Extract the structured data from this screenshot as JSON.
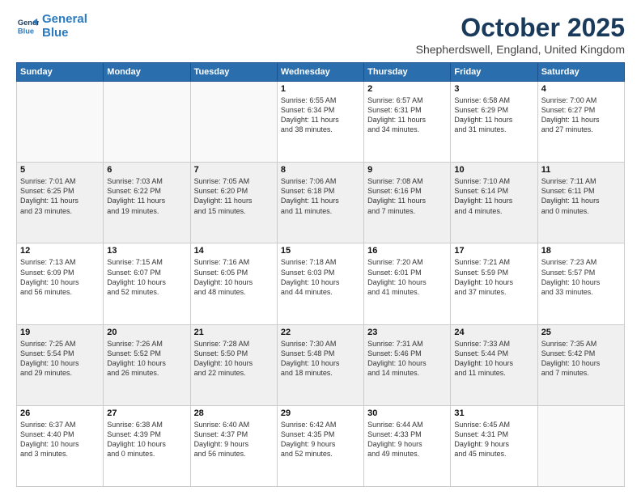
{
  "logo": {
    "line1": "General",
    "line2": "Blue"
  },
  "title": "October 2025",
  "location": "Shepherdswell, England, United Kingdom",
  "days_of_week": [
    "Sunday",
    "Monday",
    "Tuesday",
    "Wednesday",
    "Thursday",
    "Friday",
    "Saturday"
  ],
  "weeks": [
    [
      {
        "day": "",
        "info": ""
      },
      {
        "day": "",
        "info": ""
      },
      {
        "day": "",
        "info": ""
      },
      {
        "day": "1",
        "info": "Sunrise: 6:55 AM\nSunset: 6:34 PM\nDaylight: 11 hours\nand 38 minutes."
      },
      {
        "day": "2",
        "info": "Sunrise: 6:57 AM\nSunset: 6:31 PM\nDaylight: 11 hours\nand 34 minutes."
      },
      {
        "day": "3",
        "info": "Sunrise: 6:58 AM\nSunset: 6:29 PM\nDaylight: 11 hours\nand 31 minutes."
      },
      {
        "day": "4",
        "info": "Sunrise: 7:00 AM\nSunset: 6:27 PM\nDaylight: 11 hours\nand 27 minutes."
      }
    ],
    [
      {
        "day": "5",
        "info": "Sunrise: 7:01 AM\nSunset: 6:25 PM\nDaylight: 11 hours\nand 23 minutes."
      },
      {
        "day": "6",
        "info": "Sunrise: 7:03 AM\nSunset: 6:22 PM\nDaylight: 11 hours\nand 19 minutes."
      },
      {
        "day": "7",
        "info": "Sunrise: 7:05 AM\nSunset: 6:20 PM\nDaylight: 11 hours\nand 15 minutes."
      },
      {
        "day": "8",
        "info": "Sunrise: 7:06 AM\nSunset: 6:18 PM\nDaylight: 11 hours\nand 11 minutes."
      },
      {
        "day": "9",
        "info": "Sunrise: 7:08 AM\nSunset: 6:16 PM\nDaylight: 11 hours\nand 7 minutes."
      },
      {
        "day": "10",
        "info": "Sunrise: 7:10 AM\nSunset: 6:14 PM\nDaylight: 11 hours\nand 4 minutes."
      },
      {
        "day": "11",
        "info": "Sunrise: 7:11 AM\nSunset: 6:11 PM\nDaylight: 11 hours\nand 0 minutes."
      }
    ],
    [
      {
        "day": "12",
        "info": "Sunrise: 7:13 AM\nSunset: 6:09 PM\nDaylight: 10 hours\nand 56 minutes."
      },
      {
        "day": "13",
        "info": "Sunrise: 7:15 AM\nSunset: 6:07 PM\nDaylight: 10 hours\nand 52 minutes."
      },
      {
        "day": "14",
        "info": "Sunrise: 7:16 AM\nSunset: 6:05 PM\nDaylight: 10 hours\nand 48 minutes."
      },
      {
        "day": "15",
        "info": "Sunrise: 7:18 AM\nSunset: 6:03 PM\nDaylight: 10 hours\nand 44 minutes."
      },
      {
        "day": "16",
        "info": "Sunrise: 7:20 AM\nSunset: 6:01 PM\nDaylight: 10 hours\nand 41 minutes."
      },
      {
        "day": "17",
        "info": "Sunrise: 7:21 AM\nSunset: 5:59 PM\nDaylight: 10 hours\nand 37 minutes."
      },
      {
        "day": "18",
        "info": "Sunrise: 7:23 AM\nSunset: 5:57 PM\nDaylight: 10 hours\nand 33 minutes."
      }
    ],
    [
      {
        "day": "19",
        "info": "Sunrise: 7:25 AM\nSunset: 5:54 PM\nDaylight: 10 hours\nand 29 minutes."
      },
      {
        "day": "20",
        "info": "Sunrise: 7:26 AM\nSunset: 5:52 PM\nDaylight: 10 hours\nand 26 minutes."
      },
      {
        "day": "21",
        "info": "Sunrise: 7:28 AM\nSunset: 5:50 PM\nDaylight: 10 hours\nand 22 minutes."
      },
      {
        "day": "22",
        "info": "Sunrise: 7:30 AM\nSunset: 5:48 PM\nDaylight: 10 hours\nand 18 minutes."
      },
      {
        "day": "23",
        "info": "Sunrise: 7:31 AM\nSunset: 5:46 PM\nDaylight: 10 hours\nand 14 minutes."
      },
      {
        "day": "24",
        "info": "Sunrise: 7:33 AM\nSunset: 5:44 PM\nDaylight: 10 hours\nand 11 minutes."
      },
      {
        "day": "25",
        "info": "Sunrise: 7:35 AM\nSunset: 5:42 PM\nDaylight: 10 hours\nand 7 minutes."
      }
    ],
    [
      {
        "day": "26",
        "info": "Sunrise: 6:37 AM\nSunset: 4:40 PM\nDaylight: 10 hours\nand 3 minutes."
      },
      {
        "day": "27",
        "info": "Sunrise: 6:38 AM\nSunset: 4:39 PM\nDaylight: 10 hours\nand 0 minutes."
      },
      {
        "day": "28",
        "info": "Sunrise: 6:40 AM\nSunset: 4:37 PM\nDaylight: 9 hours\nand 56 minutes."
      },
      {
        "day": "29",
        "info": "Sunrise: 6:42 AM\nSunset: 4:35 PM\nDaylight: 9 hours\nand 52 minutes."
      },
      {
        "day": "30",
        "info": "Sunrise: 6:44 AM\nSunset: 4:33 PM\nDaylight: 9 hours\nand 49 minutes."
      },
      {
        "day": "31",
        "info": "Sunrise: 6:45 AM\nSunset: 4:31 PM\nDaylight: 9 hours\nand 45 minutes."
      },
      {
        "day": "",
        "info": ""
      }
    ]
  ]
}
